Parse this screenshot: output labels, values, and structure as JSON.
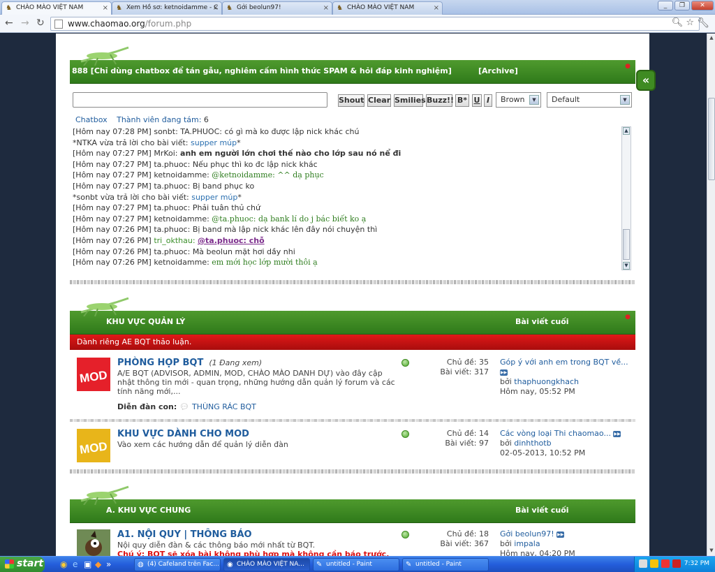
{
  "browser": {
    "tabs": [
      {
        "title": "CHÀO MÀO VIỆT NAM",
        "active": true
      },
      {
        "title": "Xem Hồ sơ: ketnoidamme - C",
        "active": false
      },
      {
        "title": "Gởi beolun97!",
        "active": false
      },
      {
        "title": "CHÀO MÀO VIỆT NAM",
        "active": false
      }
    ],
    "url_host": "www.chaomao.org",
    "url_path": "/forum.php"
  },
  "chatbox": {
    "title": "888 [Chỉ dùng chatbox để tán gẫu, nghiêm cấm hình thức SPAM & hỏi đáp kinh nghiệm]",
    "archive_label": "[Archive]",
    "buttons": {
      "shout": "Shout",
      "clear": "Clear",
      "smilies": "Smilies",
      "buzz": "Buzz!!",
      "bold": "B*",
      "underline": "U",
      "italic": "I"
    },
    "color_select": "Brown",
    "font_select": "Default",
    "tab_chatbox": "Chatbox",
    "members_label": "Thành viên đang tám:",
    "members_count": "6",
    "messages": [
      {
        "time": "[Hôm nay 07:28 PM]",
        "user": "sonbt:",
        "text": "TA.PHUOC: có gì mà ko được lập nick khác chú",
        "style": "plain"
      },
      {
        "time": "",
        "user": "*NTKA vừa trả lời cho bài viết:",
        "text": "supper múp",
        "style": "reply"
      },
      {
        "time": "[Hôm nay 07:27 PM]",
        "user": "MrKoi:",
        "text": "anh em người lớn chơi thế nào cho lớp sau nó nể đi",
        "style": "bold"
      },
      {
        "time": "[Hôm nay 07:27 PM]",
        "user": "ta.phuoc:",
        "text": "Nếu phục thì ko đc lập nick khác",
        "style": "plain"
      },
      {
        "time": "[Hôm nay 07:27 PM]",
        "user": "ketnoidamme:",
        "text": "@ketnoidamme: ^^ dạ phục",
        "style": "green"
      },
      {
        "time": "[Hôm nay 07:27 PM]",
        "user": "ta.phuoc:",
        "text": "Bị band phục ko",
        "style": "plain"
      },
      {
        "time": "",
        "user": "*sonbt vừa trả lời cho bài viết:",
        "text": "supper múp",
        "style": "reply"
      },
      {
        "time": "[Hôm nay 07:27 PM]",
        "user": "ta.phuoc:",
        "text": "Phải tuân thủ chứ",
        "style": "plain"
      },
      {
        "time": "[Hôm nay 07:27 PM]",
        "user": "ketnoidamme:",
        "text": "@ta.phuoc: dạ bank lí do j bác biết ko ạ",
        "style": "green"
      },
      {
        "time": "[Hôm nay 07:26 PM]",
        "user": "ta.phuoc:",
        "text": "Bị band mà lập nick khác lên đây nói chuyện thì",
        "style": "plain"
      },
      {
        "time": "[Hôm nay 07:26 PM]",
        "user": "tri_okthau:",
        "text": "@ta.phuoc: chỗ",
        "style": "purple"
      },
      {
        "time": "[Hôm nay 07:26 PM]",
        "user": "ta.phuoc:",
        "text": "Mà beolun mặt hơi dầy nhi",
        "style": "plain"
      },
      {
        "time": "[Hôm nay 07:26 PM]",
        "user": "ketnoidamme:",
        "text": "em mới học lớp mười thôi ạ",
        "style": "green"
      }
    ]
  },
  "sections": {
    "admin": {
      "title": "KHU VỰC QUẢN LÝ",
      "last_post_header": "Bài viết cuối",
      "subtitle": "Dành riêng AE BQT thảo luận.",
      "forums": [
        {
          "name": "PHÒNG HỌP BQT",
          "viewing": "(1 Đang xem)",
          "desc": "A/E BQT (ADVISOR, ADMIN, MOD, CHÀO MÀO DANH DỰ) vào đây cập nhật thông tin mới - quan trọng, những hướng dẫn quản lý forum và các tính năng mới,...",
          "sub_label": "Diễn đàn con:",
          "sub_forum": "THÙNG RÁC BQT",
          "topics": "Chủ đề: 35",
          "posts": "Bài viết: 317",
          "last_title": "Góp ý với anh em trong BQT về...",
          "last_by": "bởi",
          "last_user": "thaphuongkhach",
          "last_time": "Hôm nay, 05:52 PM",
          "icon_text": "MOD",
          "icon_color": "#e5202a"
        },
        {
          "name": "KHU VỰC DÀNH CHO MOD",
          "desc": "Vào xem các hướng dẫn để quản lý diễn đàn",
          "topics": "Chủ đề: 14",
          "posts": "Bài viết: 97",
          "last_title": "Các vòng loại Thi chaomao...",
          "last_by": "bởi",
          "last_user": "dinhthotb",
          "last_time": "02-05-2013, 10:52 PM",
          "icon_text": "MOD",
          "icon_color": "#e8b51a"
        }
      ]
    },
    "general": {
      "title": "A. KHU VỰC CHUNG",
      "last_post_header": "Bài viết cuối",
      "forums": [
        {
          "name": "A1. NỘI QUY | THÔNG BÁO",
          "desc": "Nội quy diễn đàn & các thông báo mới nhất từ BQT.",
          "note": "Chú ý: BQT sẽ xóa bài không phù hợp mà không cần báo trước.",
          "topics": "Chủ đề: 18",
          "posts": "Bài viết: 367",
          "last_title": "Gởi beolun97!",
          "last_by": "bởi",
          "last_user": "impala",
          "last_time": "Hôm nay, 04:20 PM"
        }
      ]
    }
  },
  "taskbar": {
    "start": "start",
    "tasks": [
      {
        "title": "(4) Cafeland trên Fac...",
        "active": false
      },
      {
        "title": "CHÀO MÀO VIỆT NA...",
        "active": true
      },
      {
        "title": "untitled - Paint",
        "active": false
      },
      {
        "title": "untitled - Paint",
        "active": false
      }
    ],
    "clock": "7:32 PM"
  }
}
